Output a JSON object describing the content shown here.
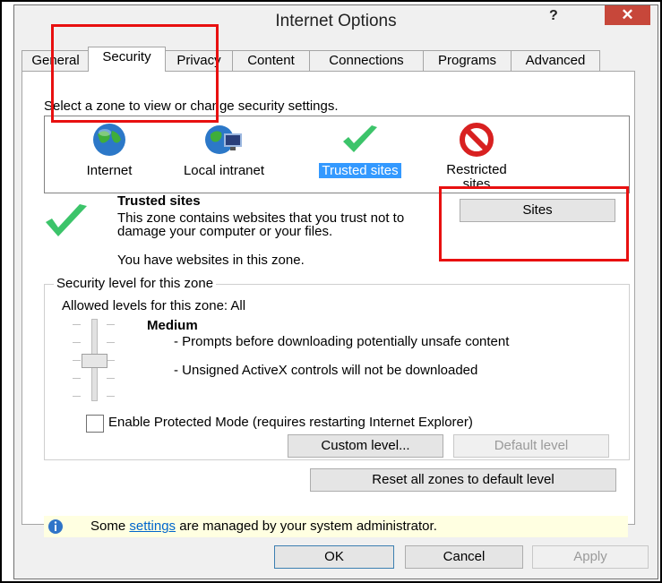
{
  "window": {
    "title": "Internet Options",
    "help_glyph": "?",
    "close_glyph": "✕"
  },
  "tabs": [
    {
      "label": "General"
    },
    {
      "label": "Security"
    },
    {
      "label": "Privacy"
    },
    {
      "label": "Content"
    },
    {
      "label": "Connections"
    },
    {
      "label": "Programs"
    },
    {
      "label": "Advanced"
    }
  ],
  "security": {
    "zone_prompt": "Select a zone to view or change security settings.",
    "zones": [
      {
        "label": "Internet",
        "icon": "globe-icon"
      },
      {
        "label": "Local intranet",
        "icon": "intranet-icon"
      },
      {
        "label": "Trusted sites",
        "icon": "checkmark-icon",
        "selected": true
      },
      {
        "label": "Restricted sites",
        "icon": "restricted-icon"
      }
    ],
    "zone_title": "Trusted sites",
    "zone_description": "This zone contains websites that you trust not to damage your computer or your files.",
    "zone_status": "You have websites in this zone.",
    "sites_button": "Sites",
    "level_group_label": "Security level for this zone",
    "allowed_levels": "Allowed levels for this zone: All",
    "level_name": "Medium",
    "level_bullets": [
      "- Prompts before downloading potentially unsafe content",
      "- Unsigned ActiveX controls will not be downloaded"
    ],
    "slider_level": 2,
    "slider_level_count": 5,
    "protected_mode_label": "Enable Protected Mode (requires restarting Internet Explorer)",
    "protected_mode_checked": false,
    "custom_level_button": "Custom level...",
    "default_level_button": "Default level",
    "reset_button": "Reset all zones to default level",
    "notice_prefix": "Some ",
    "notice_link": "settings",
    "notice_suffix": " are managed by your system administrator."
  },
  "footer": {
    "ok": "OK",
    "cancel": "Cancel",
    "apply": "Apply"
  },
  "colors": {
    "selection": "#3399ff",
    "annotation_red": "#e81010",
    "close_red": "#c7473a",
    "notice_bg": "#ffffe1"
  }
}
